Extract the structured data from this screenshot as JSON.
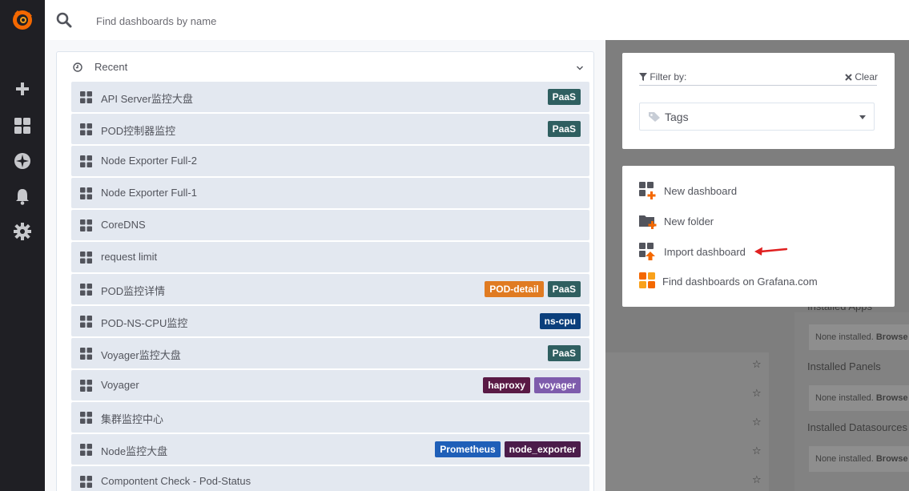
{
  "search": {
    "placeholder": "Find dashboards by name"
  },
  "recent": {
    "title": "Recent",
    "items": [
      {
        "name": "API Server监控大盘",
        "tags": [
          {
            "label": "PaaS",
            "color": "#2f5f60"
          }
        ]
      },
      {
        "name": "POD控制器监控",
        "tags": [
          {
            "label": "PaaS",
            "color": "#2f5f60"
          }
        ]
      },
      {
        "name": "Node Exporter Full-2",
        "tags": []
      },
      {
        "name": "Node Exporter Full-1",
        "tags": []
      },
      {
        "name": "CoreDNS",
        "tags": []
      },
      {
        "name": "request limit",
        "tags": []
      },
      {
        "name": "POD监控详情",
        "tags": [
          {
            "label": "POD-detail",
            "color": "#e07b22"
          },
          {
            "label": "PaaS",
            "color": "#2f5f60"
          }
        ]
      },
      {
        "name": "POD-NS-CPU监控",
        "tags": [
          {
            "label": "ns-cpu",
            "color": "#0b3f7c"
          }
        ]
      },
      {
        "name": "Voyager监控大盘",
        "tags": [
          {
            "label": "PaaS",
            "color": "#2f5f60"
          }
        ]
      },
      {
        "name": "Voyager",
        "tags": [
          {
            "label": "haproxy",
            "color": "#5a1a45"
          },
          {
            "label": "voyager",
            "color": "#7e5cac"
          }
        ]
      },
      {
        "name": "集群监控中心",
        "tags": []
      },
      {
        "name": "Node监控大盘",
        "tags": [
          {
            "label": "Prometheus",
            "color": "#1f5fb8"
          },
          {
            "label": "node_exporter",
            "color": "#4b1c4a"
          }
        ]
      },
      {
        "name": "Compontent Check - Pod-Status",
        "tags": []
      }
    ]
  },
  "filter": {
    "label": "Filter by:",
    "clear_label": "Clear",
    "tags_placeholder": "Tags"
  },
  "actions": {
    "new_dashboard": "New dashboard",
    "new_folder": "New folder",
    "import_dashboard": "Import dashboard",
    "find_dashboards": "Find dashboards on Grafana.com"
  },
  "background": {
    "installed_apps": "Installed Apps",
    "installed_panels": "Installed Panels",
    "installed_datasources": "Installed Datasources",
    "none_installed": "None installed.",
    "browse": "Browse"
  },
  "colors": {
    "sidebar": "#1f1f24",
    "brand": "#f46800",
    "row_bg": "#e3e8f0",
    "arrow": "#e02020"
  },
  "icons": [
    "grafana-logo-icon",
    "plus-icon",
    "dashboards-icon",
    "explore-icon",
    "bell-icon",
    "gear-icon",
    "search-icon",
    "clock-icon",
    "chevron-down-icon",
    "dashboard-grid-icon",
    "filter-icon",
    "close-icon",
    "tag-icon",
    "caret-down-icon",
    "new-dashboard-icon",
    "new-folder-icon",
    "import-dashboard-icon",
    "grafana-com-icon",
    "star-icon",
    "red-arrow-icon"
  ]
}
